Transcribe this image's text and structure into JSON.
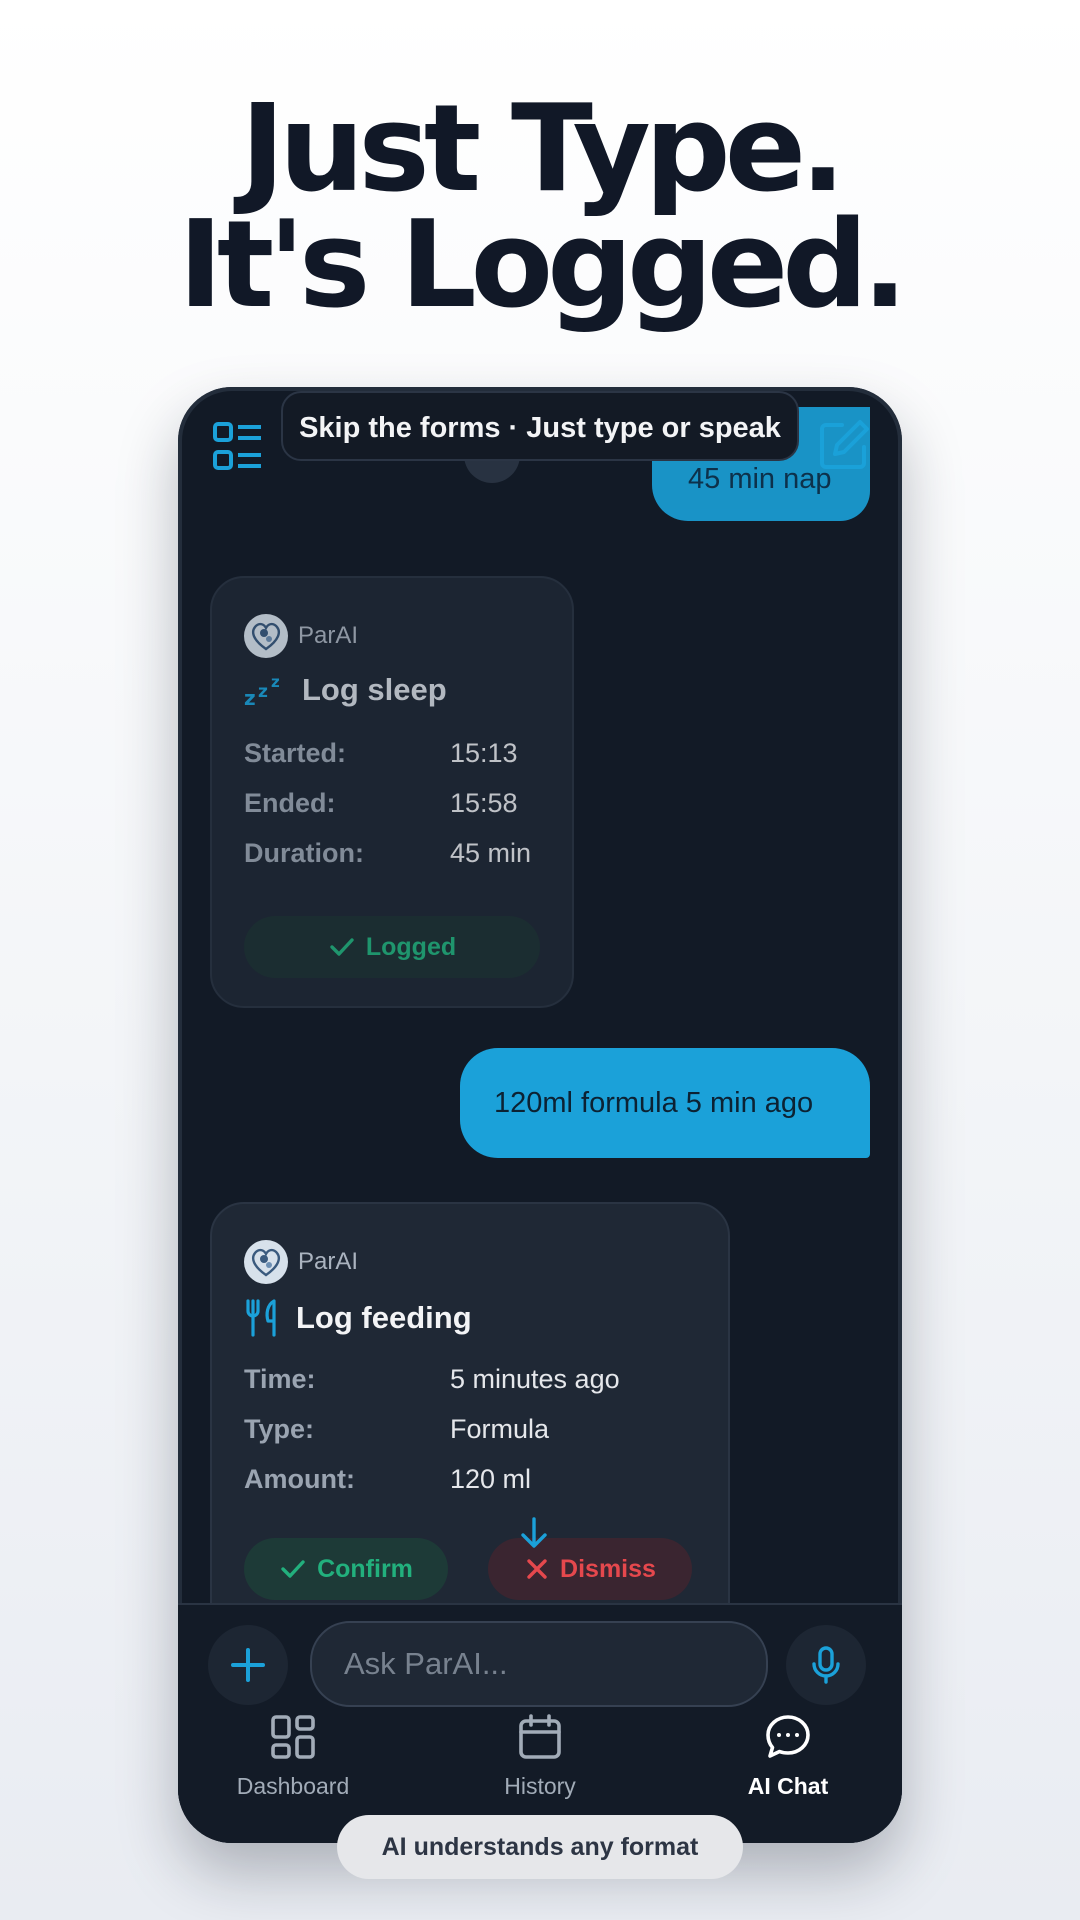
{
  "headline": {
    "line1": "Just Type.",
    "line2": "It's Logged."
  },
  "top_pill": "Skip the forms · Just type or speak",
  "bottom_pill": "AI understands any format",
  "messages": {
    "user_nap": "45 min nap",
    "sleep_card": {
      "brand": "ParAI",
      "title": "Log sleep",
      "icon": "zzz-icon",
      "rows": [
        {
          "key": "Started:",
          "value": "15:13"
        },
        {
          "key": "Ended:",
          "value": "15:58"
        },
        {
          "key": "Duration:",
          "value": "45 min"
        }
      ],
      "status": "Logged"
    },
    "user_formula": "120ml formula 5 min ago",
    "feeding_card": {
      "brand": "ParAI",
      "title": "Log feeding",
      "icon": "utensils-icon",
      "rows": [
        {
          "key": "Time:",
          "value": "5 minutes ago"
        },
        {
          "key": "Type:",
          "value": "Formula"
        },
        {
          "key": "Amount:",
          "value": "120 ml"
        }
      ],
      "confirm_label": "Confirm",
      "dismiss_label": "Dismiss"
    }
  },
  "composer": {
    "placeholder": "Ask ParAI..."
  },
  "nav": [
    {
      "label": "Dashboard",
      "icon": "grid-icon",
      "active": false
    },
    {
      "label": "History",
      "icon": "calendar-icon",
      "active": false
    },
    {
      "label": "AI Chat",
      "icon": "chat-icon",
      "active": true
    }
  ],
  "colors": {
    "accent": "#1ba1d9",
    "success": "#22b07d",
    "danger": "#e5484d",
    "background": "#121a26"
  }
}
